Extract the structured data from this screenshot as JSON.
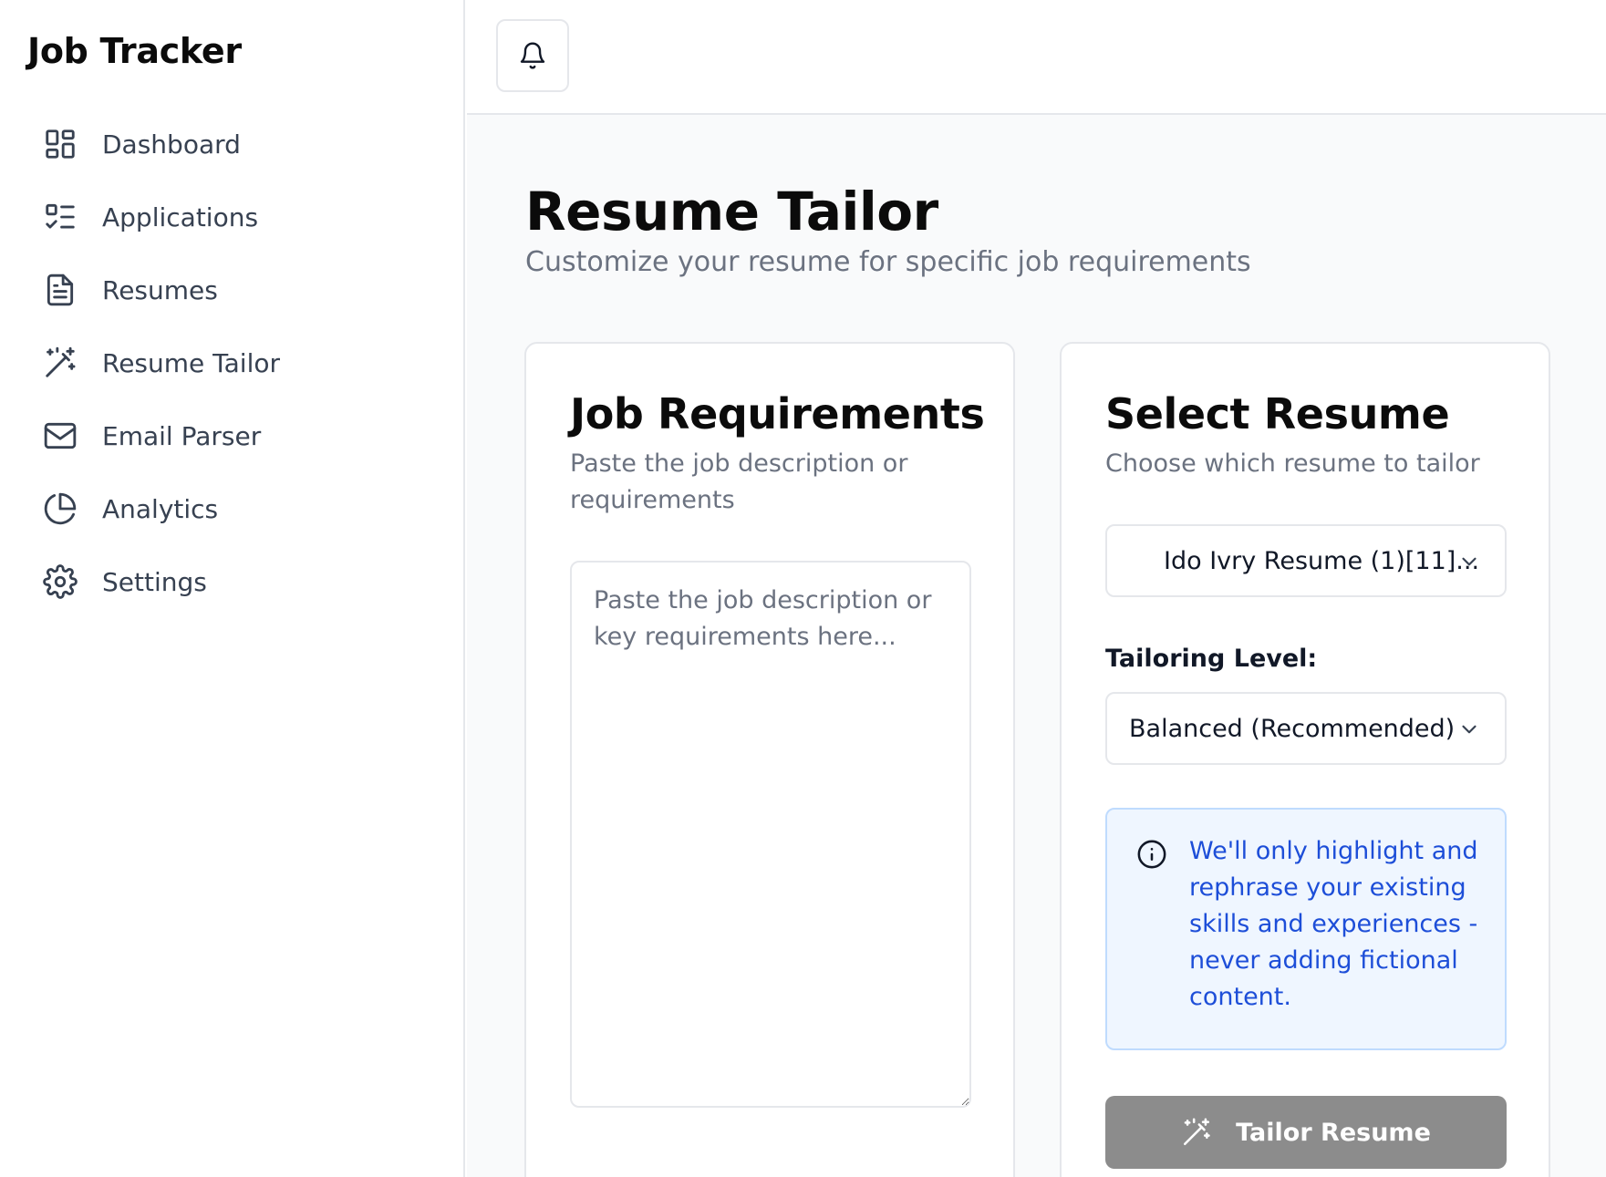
{
  "sidebar": {
    "brand": "Job Tracker",
    "items": [
      {
        "label": "Dashboard",
        "icon": "dashboard-icon"
      },
      {
        "label": "Applications",
        "icon": "checklist-icon"
      },
      {
        "label": "Resumes",
        "icon": "document-icon"
      },
      {
        "label": "Resume Tailor",
        "icon": "magic-wand-icon"
      },
      {
        "label": "Email Parser",
        "icon": "mail-icon"
      },
      {
        "label": "Analytics",
        "icon": "pie-chart-icon"
      },
      {
        "label": "Settings",
        "icon": "gear-icon"
      }
    ]
  },
  "header": {
    "notification_icon": "bell-icon"
  },
  "page": {
    "title": "Resume Tailor",
    "subtitle": "Customize your resume for specific job requirements"
  },
  "job_card": {
    "title": "Job Requirements",
    "description": "Paste the job description or requirements",
    "textarea_placeholder": "Paste the job description or key requirements here...",
    "textarea_value": ""
  },
  "resume_card": {
    "title": "Select Resume",
    "description": "Choose which resume to tailor",
    "selected_resume": "Ido Ivry Resume (1)[11]...",
    "tailoring_label": "Tailoring Level:",
    "tailoring_value": "Balanced (Recommended)",
    "info_text": "We'll only highlight and rephrase your existing skills and experiences - never adding fictional content.",
    "button_label": "Tailor Resume"
  },
  "colors": {
    "info_text": "#1d4ed8",
    "info_bg": "#eff6ff",
    "button_disabled": "#8c8c8c",
    "muted_text": "#6b7280"
  }
}
